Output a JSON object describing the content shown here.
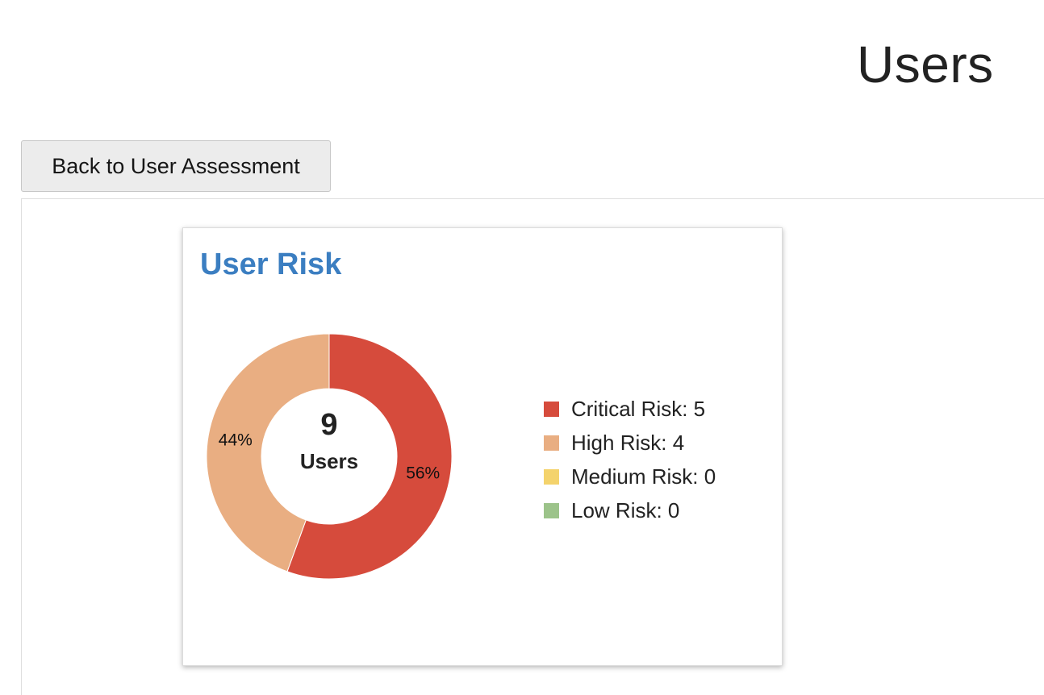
{
  "page": {
    "title": "Users"
  },
  "toolbar": {
    "back_label": "Back to User Assessment"
  },
  "card": {
    "title": "User Risk",
    "center_count": "9",
    "center_label": "Users"
  },
  "colors": {
    "title_blue": "#3b7ec1",
    "critical": "#d64b3c",
    "high": "#e9ae82",
    "medium": "#f4d36c",
    "low": "#9cc38a"
  },
  "legend": {
    "critical": "Critical Risk: 5",
    "high": "High Risk: 4",
    "medium": "Medium Risk: 0",
    "low": "Low Risk: 0"
  },
  "chart_data": {
    "type": "pie",
    "donut": true,
    "title": "User Risk",
    "center_text": [
      "9",
      "Users"
    ],
    "categories": [
      "Critical Risk",
      "High Risk",
      "Medium Risk",
      "Low Risk"
    ],
    "values": [
      5,
      4,
      0,
      0
    ],
    "colors": [
      "#d64b3c",
      "#e9ae82",
      "#f4d36c",
      "#9cc38a"
    ],
    "slice_labels": [
      "56%",
      "44%",
      "",
      ""
    ],
    "legend_position": "right"
  }
}
